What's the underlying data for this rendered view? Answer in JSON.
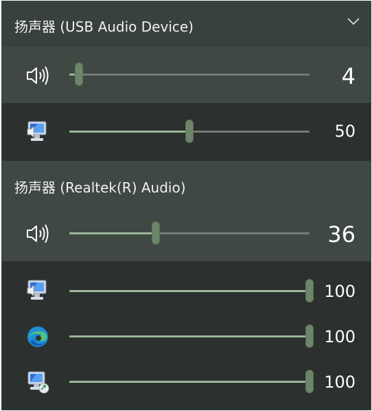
{
  "devices": [
    {
      "title": "扬声器 (USB Audio Device)",
      "master": {
        "icon": "speaker-volume-icon",
        "value": "4",
        "level": 4
      },
      "apps": [
        {
          "icon": "system-sounds-monitor-icon",
          "value": "50",
          "level": 50
        }
      ]
    },
    {
      "title": "扬声器 (Realtek(R) Audio)",
      "master": {
        "icon": "speaker-volume-icon",
        "value": "36",
        "level": 36
      },
      "apps": [
        {
          "icon": "system-sounds-monitor-icon",
          "value": "100",
          "level": 100
        },
        {
          "icon": "edge-browser-icon",
          "value": "100",
          "level": 100
        },
        {
          "icon": "remote-desktop-icon",
          "value": "100",
          "level": 100
        }
      ]
    }
  ],
  "colors": {
    "track_fill": "#9db89a",
    "thumb": "#6d8569",
    "track_empty": "#767b78"
  }
}
